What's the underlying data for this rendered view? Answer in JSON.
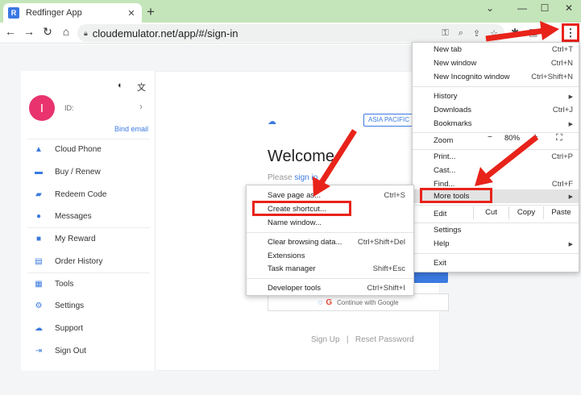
{
  "tab": {
    "title": "Redfinger App"
  },
  "toolbar": {
    "url": "cloudemulator.net/app/#/sign-in"
  },
  "sidebar": {
    "user_initial": "I",
    "user_id": "ID:",
    "bind_email": "Bind email",
    "items": [
      {
        "label": "Cloud Phone",
        "icon": "cloud-phone-icon"
      },
      {
        "label": "Buy / Renew",
        "icon": "buy-icon"
      },
      {
        "label": "Redeem Code",
        "icon": "ticket-icon"
      },
      {
        "label": "Messages",
        "icon": "message-icon"
      },
      {
        "label": "My Reward",
        "icon": "gift-icon"
      },
      {
        "label": "Order History",
        "icon": "order-icon"
      },
      {
        "label": "Tools",
        "icon": "tools-icon"
      },
      {
        "label": "Settings",
        "icon": "gear-icon"
      },
      {
        "label": "Support",
        "icon": "support-icon"
      },
      {
        "label": "Sign Out",
        "icon": "sign-out-icon"
      }
    ]
  },
  "main": {
    "region": "ASIA PACIFIC",
    "welcome": "Welcome",
    "please": "Please",
    "sign_in": "sign in",
    "google_button": "Continue with Google",
    "sign_up": "Sign Up",
    "separator": "|",
    "reset_password": "Reset Password"
  },
  "chrome_menu": {
    "new_tab": {
      "label": "New tab",
      "shortcut": "Ctrl+T"
    },
    "new_window": {
      "label": "New window",
      "shortcut": "Ctrl+N"
    },
    "new_incognito": {
      "label": "New Incognito window",
      "shortcut": "Ctrl+Shift+N"
    },
    "history": {
      "label": "History"
    },
    "downloads": {
      "label": "Downloads",
      "shortcut": "Ctrl+J"
    },
    "bookmarks": {
      "label": "Bookmarks"
    },
    "zoom": {
      "label": "Zoom",
      "minus": "−",
      "value": "80%",
      "plus": "+"
    },
    "print": {
      "label": "Print...",
      "shortcut": "Ctrl+P"
    },
    "cast": {
      "label": "Cast..."
    },
    "find": {
      "label": "Find...",
      "shortcut": "Ctrl+F"
    },
    "more_tools": {
      "label": "More tools"
    },
    "edit": {
      "label": "Edit",
      "cut": "Cut",
      "copy": "Copy",
      "paste": "Paste"
    },
    "settings": {
      "label": "Settings"
    },
    "help": {
      "label": "Help"
    },
    "exit": {
      "label": "Exit"
    }
  },
  "more_tools_menu": {
    "save_page": {
      "label": "Save page as...",
      "shortcut": "Ctrl+S"
    },
    "create_shortcut": {
      "label": "Create shortcut..."
    },
    "name_window": {
      "label": "Name window..."
    },
    "clear_data": {
      "label": "Clear browsing data...",
      "shortcut": "Ctrl+Shift+Del"
    },
    "extensions": {
      "label": "Extensions"
    },
    "task_manager": {
      "label": "Task manager",
      "shortcut": "Shift+Esc"
    },
    "dev_tools": {
      "label": "Developer tools",
      "shortcut": "Ctrl+Shift+I"
    }
  },
  "colors": {
    "annotation": "#e8231a",
    "accent": "#3b7ae0",
    "tabstrip": "#c4e5b9",
    "avatar": "#e8336e"
  }
}
